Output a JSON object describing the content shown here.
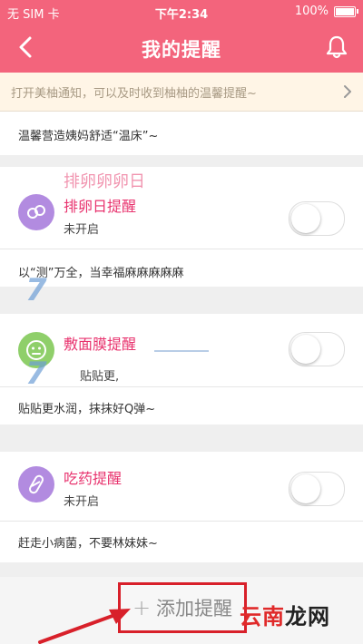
{
  "status_bar": {
    "carrier": "无 SIM 卡",
    "time": "下午2:34",
    "battery": "100%",
    "battery_level": 1.0
  },
  "nav": {
    "title": "我的提醒",
    "back_icon": "chevron-left-icon",
    "bell_icon": "bell-icon"
  },
  "notice": {
    "text": "打开美柚通知，可以及时收到柚柚的温馨提醒~"
  },
  "card1": {
    "desc": "温馨营造姨妈舒适“温床”~"
  },
  "reminders": [
    {
      "title": "排卵日提醒",
      "ghost_title": "排卵卵卵日",
      "status": "未开启",
      "desc": "以“测”万全，当幸福麻麻麻麻麻",
      "enabled": false,
      "icon": "ovulation-icon",
      "icon_color": "#b28be0"
    },
    {
      "title": "敷面膜提醒",
      "status": "贴贴更,",
      "desc": "贴贴更水润，抹抹好Q弹~",
      "enabled": false,
      "icon": "face-mask-icon",
      "icon_color": "#8fcf6a"
    },
    {
      "title": "吃药提醒",
      "status": "未开启",
      "desc": "赶走小病菌，不要林妹妹~",
      "enabled": false,
      "icon": "pill-icon",
      "icon_color": "#b28be0"
    }
  ],
  "add_button": {
    "plus": "+",
    "label": "添加提醒"
  },
  "site_mark": {
    "part1": "云南",
    "part2": "龙网"
  },
  "colors": {
    "brand": "#f3647c",
    "accent_title": "#e8336e",
    "highlight_box": "#d8202a"
  }
}
